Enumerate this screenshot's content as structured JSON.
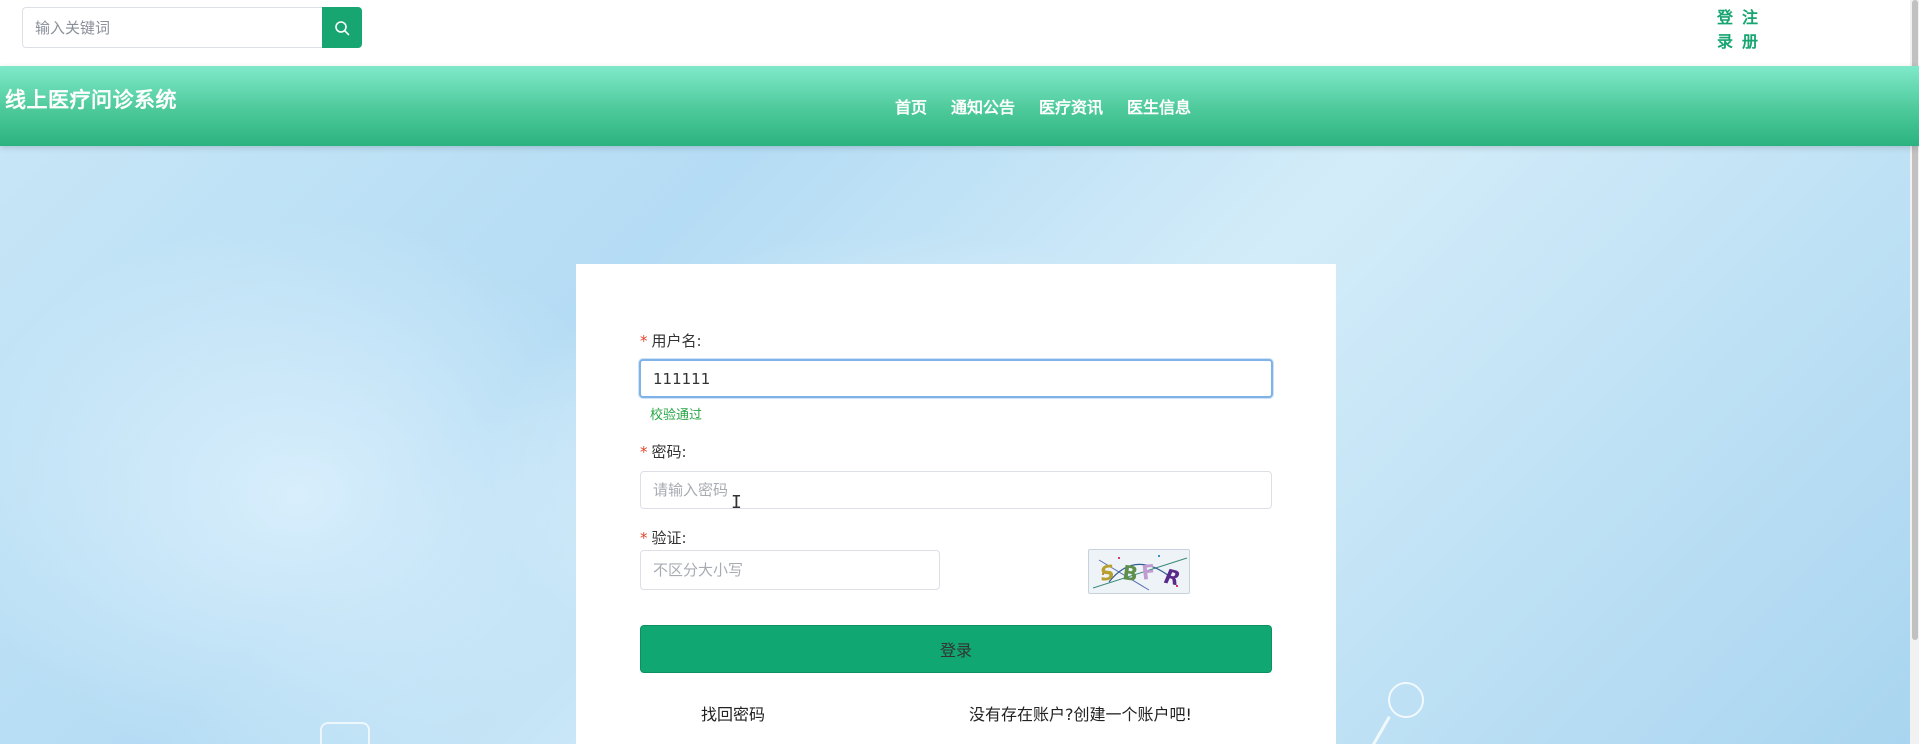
{
  "top_bar": {
    "search": {
      "placeholder": "输入关键词",
      "value": "",
      "button_icon": "search-icon"
    },
    "login_link": "登录",
    "register_link": "注册"
  },
  "header": {
    "site_title": "线上医疗问诊系统",
    "nav": [
      "首页",
      "通知公告",
      "医疗资讯",
      "医生信息"
    ]
  },
  "login_form": {
    "username": {
      "label": "用户名:",
      "required_mark": "*",
      "value": "111111",
      "validation_message": "校验通过"
    },
    "password": {
      "label": "密码:",
      "required_mark": "*",
      "placeholder": "请输入密码",
      "value": ""
    },
    "captcha": {
      "label": "验证:",
      "required_mark": "*",
      "placeholder": "不区分大小写",
      "value": "",
      "image_text": "SBFR"
    },
    "submit_label": "登录",
    "forgot_password_link": "找回密码",
    "register_prompt_link": "没有存在账户?创建一个账户吧!"
  },
  "colors": {
    "brand_green": "#17a571",
    "button_green": "#11a772",
    "required_red": "#e0452b",
    "valid_green": "#28a745"
  }
}
